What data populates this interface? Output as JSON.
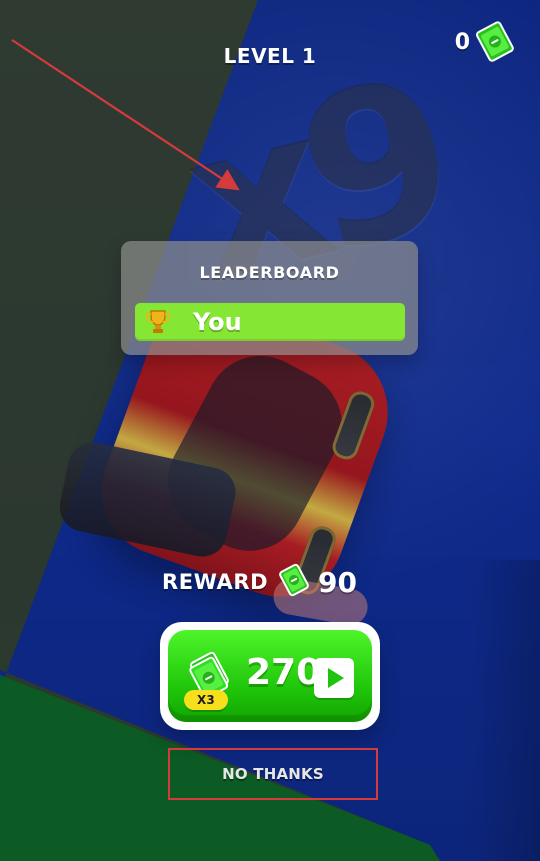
{
  "hud": {
    "level_text": "LEVEL 1",
    "cash_count": "0",
    "cash_icon": "cash-bill-icon"
  },
  "scene": {
    "multiplier_text": "x9"
  },
  "leaderboard": {
    "title": "LEADERBOARD",
    "entries": [
      {
        "name": "You",
        "icon": "trophy-icon"
      }
    ]
  },
  "reward": {
    "label": "REWARD",
    "value": "90",
    "icon": "cash-bill-icon"
  },
  "claim_button": {
    "amount": "270",
    "multiplier_badge": "X3",
    "icon": "cash-stack-icon",
    "play_icon": "play-icon"
  },
  "secondary_action": {
    "label": "NO THANKS"
  },
  "colors": {
    "track_blue": "#0E2A8C",
    "accent_green": "#21C70B",
    "leaderboard_green": "#86E634",
    "annotation_red": "#D63B3B"
  }
}
